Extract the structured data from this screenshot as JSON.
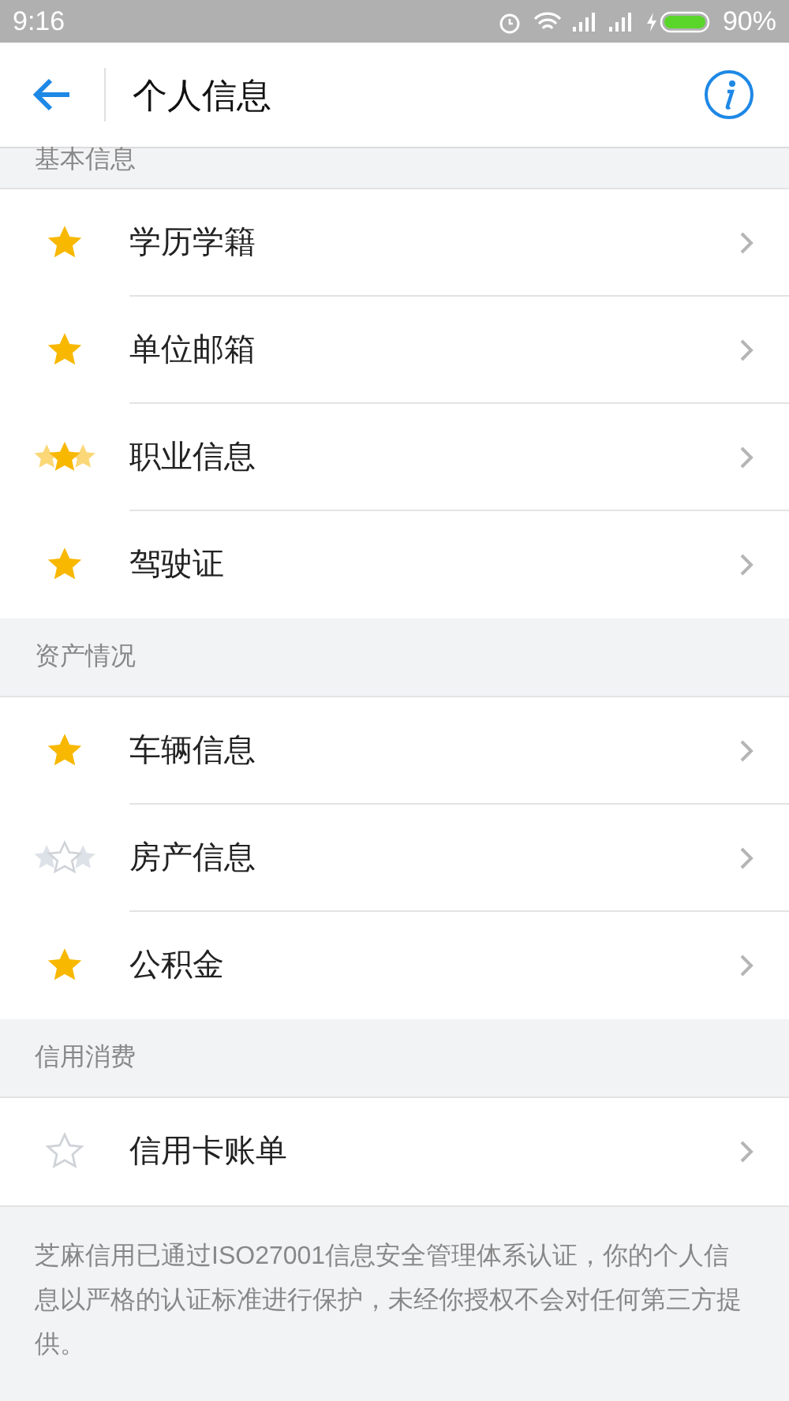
{
  "status_bar": {
    "time": "9:16",
    "battery": "90%"
  },
  "header": {
    "title": "个人信息"
  },
  "sections": [
    {
      "title": "基本信息",
      "items": [
        {
          "label": "学历学籍",
          "kind": "star"
        },
        {
          "label": "单位邮箱",
          "kind": "star"
        },
        {
          "label": "职业信息",
          "kind": "stars"
        },
        {
          "label": "驾驶证",
          "kind": "star"
        }
      ]
    },
    {
      "title": "资产情况",
      "items": [
        {
          "label": "车辆信息",
          "kind": "star"
        },
        {
          "label": "房产信息",
          "kind": "stars-empty"
        },
        {
          "label": "公积金",
          "kind": "star"
        }
      ]
    },
    {
      "title": "信用消费",
      "items": [
        {
          "label": "信用卡账单",
          "kind": "star-empty"
        }
      ]
    }
  ],
  "footer": "芝麻信用已通过ISO27001信息安全管理体系认证，你的个人信息以严格的认证标准进行保护，未经你授权不会对任何第三方提供。"
}
